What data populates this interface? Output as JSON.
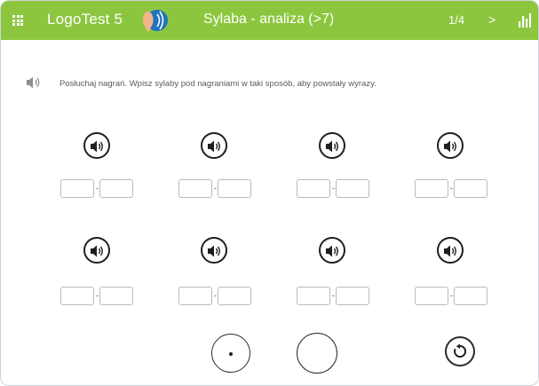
{
  "header": {
    "app_title": "LogoTest 5",
    "exercise_title": "Sylaba - analiza (>7)",
    "progress": "1/4",
    "next_label": ">",
    "bar_color": "#8cc63f",
    "icons": [
      "apps-grid-icon",
      "ear-logo-icon",
      "stats-icon"
    ]
  },
  "instruction": {
    "text": "Posłuchaj nagrań. Wpisz sylaby pod nagraniami w taki sposób, aby powstały wyrazy.",
    "icon": "speaker-icon"
  },
  "words": [
    {
      "syllable_1": "",
      "syllable_2": "",
      "separator": "-"
    },
    {
      "syllable_1": "",
      "syllable_2": "",
      "separator": "-"
    },
    {
      "syllable_1": "",
      "syllable_2": "",
      "separator": "-"
    },
    {
      "syllable_1": "",
      "syllable_2": "",
      "separator": "-"
    },
    {
      "syllable_1": "",
      "syllable_2": "",
      "separator": "-"
    },
    {
      "syllable_1": "",
      "syllable_2": "",
      "separator": "-"
    },
    {
      "syllable_1": "",
      "syllable_2": "",
      "separator": "-"
    },
    {
      "syllable_1": "",
      "syllable_2": "",
      "separator": "-"
    }
  ],
  "controls": {
    "icons": [
      "dot-button-icon",
      "empty-circle-button",
      "reset-icon"
    ]
  }
}
